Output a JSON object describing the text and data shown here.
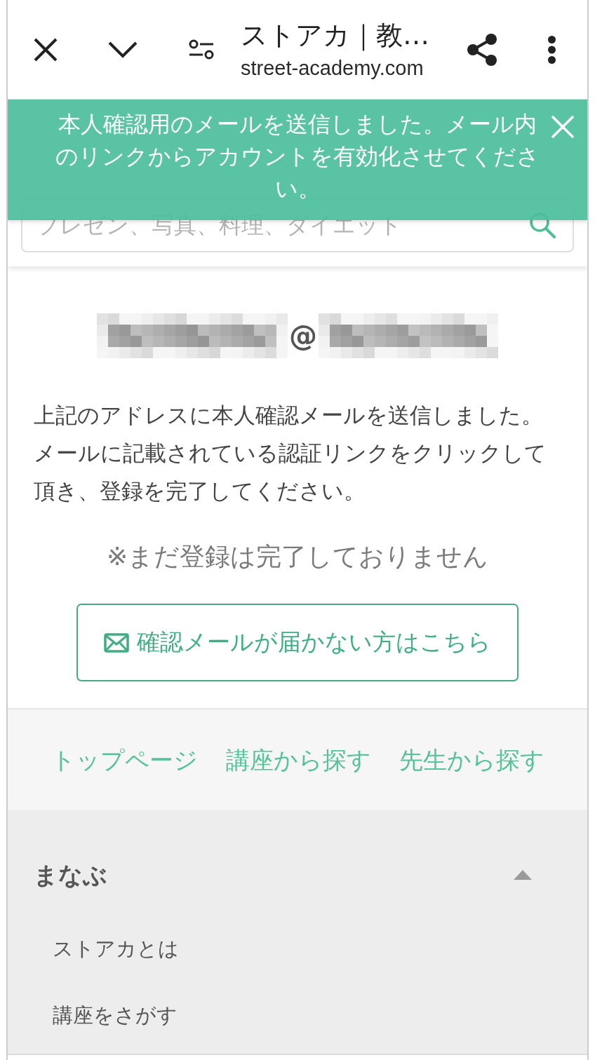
{
  "browser_bar": {
    "title": "ストアカ｜教…",
    "url": "street-academy.com"
  },
  "toast": {
    "message": "本人確認用のメールを送信しました。メール内のリンクからアカウントを有効化させてください。"
  },
  "search": {
    "placeholder": "プレゼン、写真、料理、ダイエット"
  },
  "email": {
    "at_sign": "@"
  },
  "message": "上記のアドレスに本人確認メールを送信しました。メールに記載されている認証リンクをクリックして頂き、登録を完了してください。",
  "notice": "※まだ登録は完了しておりません",
  "resend_button": {
    "label": "確認メールが届かない方はこちら"
  },
  "footer_links": [
    "トップページ",
    "講座から探す",
    "先生から探す"
  ],
  "accordion": {
    "title": "まなぶ",
    "expanded": true,
    "items": [
      "ストアカとは",
      "講座をさがす"
    ]
  }
}
